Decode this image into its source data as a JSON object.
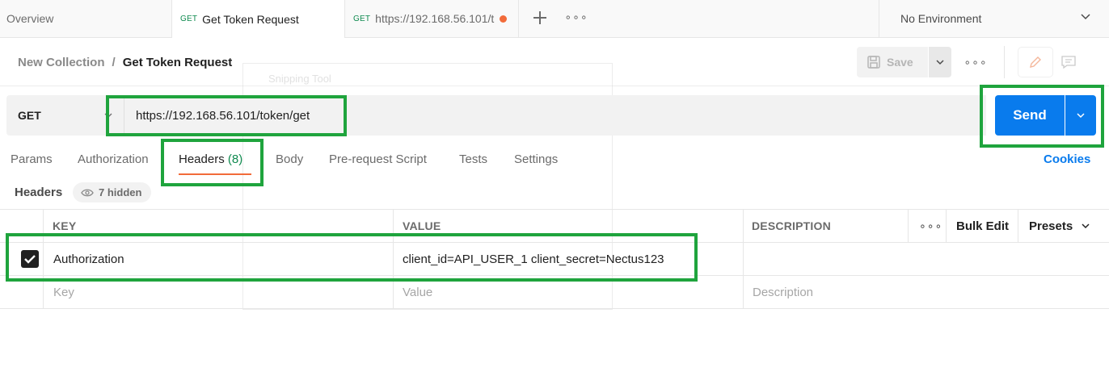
{
  "tabs": {
    "overview_label": "Overview",
    "active_method": "GET",
    "active_label": "Get Token Request",
    "url_tab_method": "GET",
    "url_tab_label": "https://192.168.56.101/t"
  },
  "environment": {
    "selected": "No Environment"
  },
  "breadcrumb": {
    "collection": "New Collection",
    "separator": "/",
    "request": "Get Token Request"
  },
  "toolbar": {
    "save_label": "Save"
  },
  "overlay": {
    "label": "Snipping Tool"
  },
  "request": {
    "method": "GET",
    "url": "https://192.168.56.101/token/get",
    "send_label": "Send"
  },
  "request_tabs": {
    "params": "Params",
    "authorization": "Authorization",
    "headers": "Headers",
    "headers_count": "(8)",
    "body": "Body",
    "pre_request": "Pre-request Script",
    "tests": "Tests",
    "settings": "Settings",
    "cookies": "Cookies"
  },
  "headers_section": {
    "title": "Headers",
    "hidden_label": "7 hidden"
  },
  "table": {
    "columns": {
      "key": "KEY",
      "value": "VALUE",
      "description": "DESCRIPTION"
    },
    "bulk_edit_label": "Bulk Edit",
    "presets_label": "Presets",
    "rows": [
      {
        "checked": true,
        "key": "Authorization",
        "value": "client_id=API_USER_1 client_secret=Nectus123",
        "description": ""
      }
    ],
    "placeholders": {
      "key": "Key",
      "value": "Value",
      "description": "Description"
    }
  },
  "colors": {
    "accent_send": "#097bed",
    "active_tab_underline": "#f26b3a",
    "method_get": "#0f8a4f",
    "highlight": "#1fa43d"
  }
}
